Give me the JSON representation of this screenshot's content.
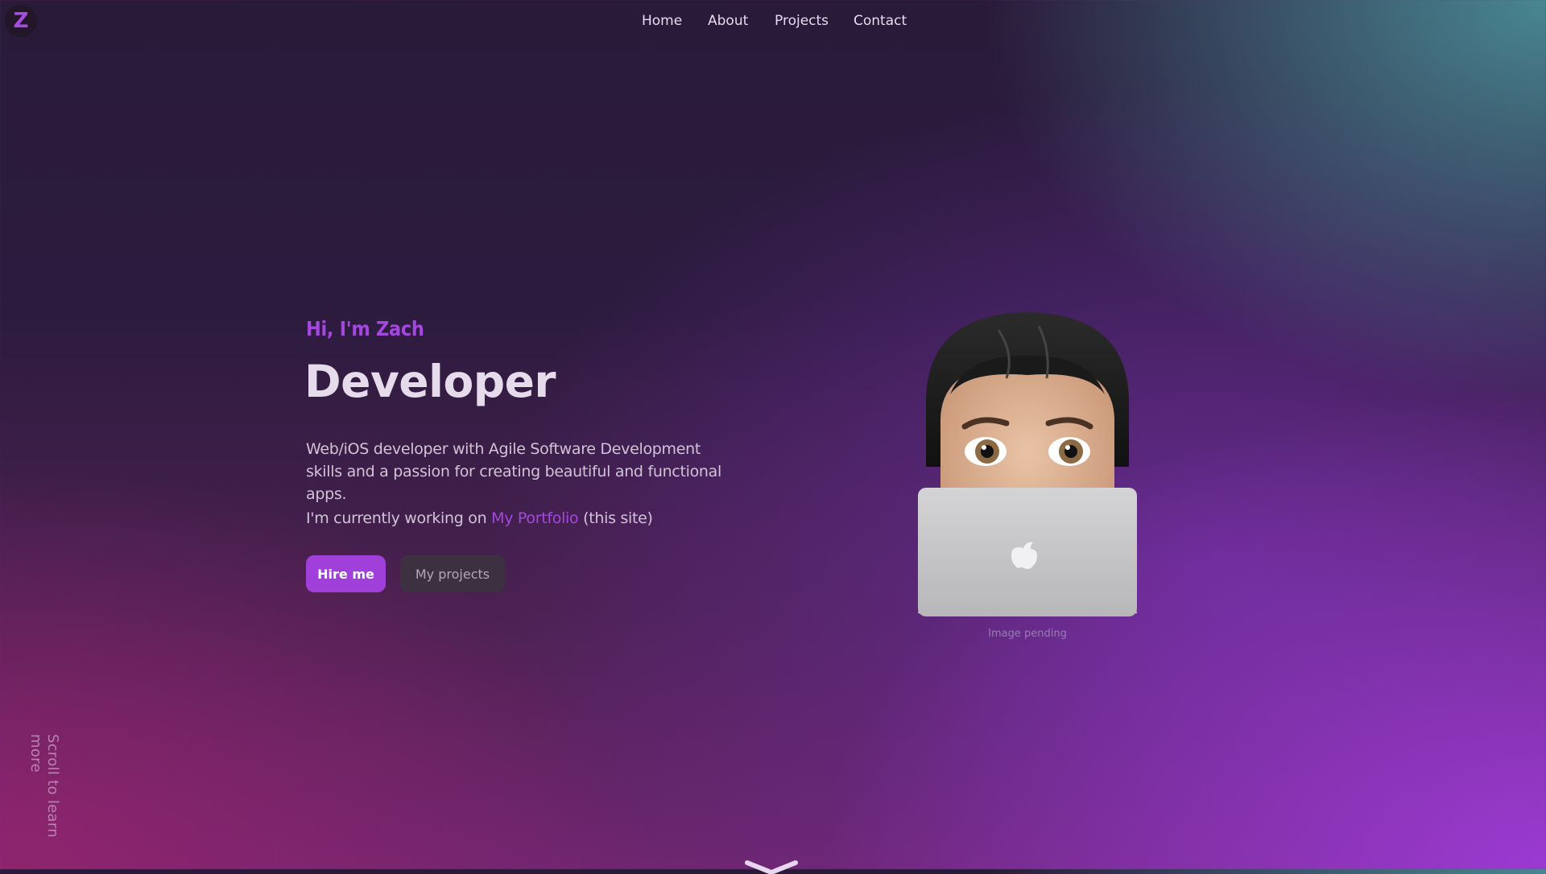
{
  "logo": {
    "letter": "Z"
  },
  "nav": {
    "items": [
      {
        "label": "Home"
      },
      {
        "label": "About"
      },
      {
        "label": "Projects"
      },
      {
        "label": "Contact"
      }
    ]
  },
  "hero": {
    "greeting": "Hi, I'm Zach",
    "title": "Developer",
    "description": "Web/iOS developer with Agile Software Development skills and a passion for creating beautiful and functional apps.",
    "working_prefix": "I'm currently working on",
    "working_link": "My Portfolio",
    "working_suffix": "(this site)",
    "buttons": {
      "primary": "Hire me",
      "secondary": "My projects"
    }
  },
  "avatar": {
    "icon": "memoji-avatar-with-laptop",
    "caption": "Image pending"
  },
  "scroll_hint": "Scroll to learn more",
  "colors": {
    "accent": "#a347df",
    "button_primary": "#a03fd9",
    "button_secondary": "#3d3041",
    "text_light": "#e6dbeb"
  }
}
